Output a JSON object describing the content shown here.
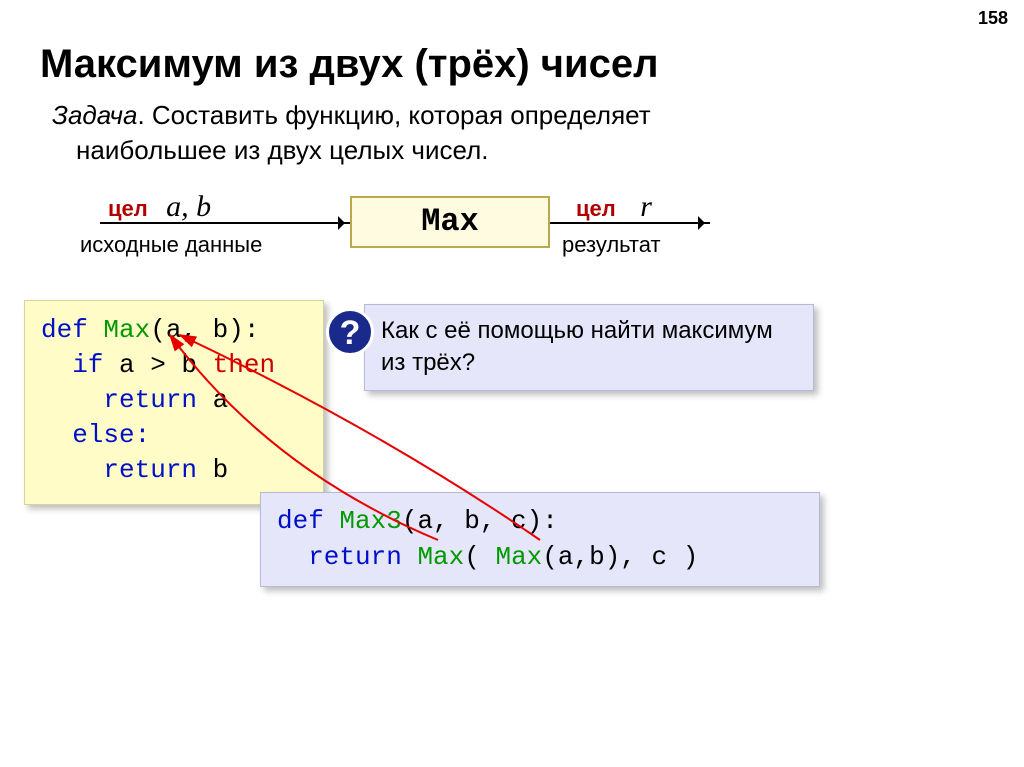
{
  "page_number": "158",
  "title": "Максимум из двух (трёх) чисел",
  "task_prefix": "Задача",
  "task_line1": ". Составить функцию, которая определяет",
  "task_line2": "наибольшее из двух целых чисел.",
  "diagram": {
    "maxbox": "Max",
    "tsel_left": "цел",
    "vars_left": "a, b",
    "inputs_label": "исходные данные",
    "tsel_right": "цел",
    "var_right": "r",
    "result_label": "результат"
  },
  "code1": {
    "l1_def": "def ",
    "l1_fn": "Max",
    "l1_rest": "(a, b):",
    "l2_if": "  if",
    "l2_mid": " a > b ",
    "l2_then": "then",
    "l3": "    return ",
    "l3_a": "a",
    "l4": "  else:",
    "l5": "    return ",
    "l5_b": "b"
  },
  "question": {
    "mark": "?",
    "text": "Как с её помощью найти максимум из трёх?"
  },
  "code2": {
    "l1_def": "def ",
    "l1_fn": "Max3",
    "l1_rest": "(a, b, c):",
    "l2_ret": "  return ",
    "l2_m1": "Max",
    "l2_p1": "( ",
    "l2_m2": "Max",
    "l2_p2": "(a,b), c )"
  }
}
